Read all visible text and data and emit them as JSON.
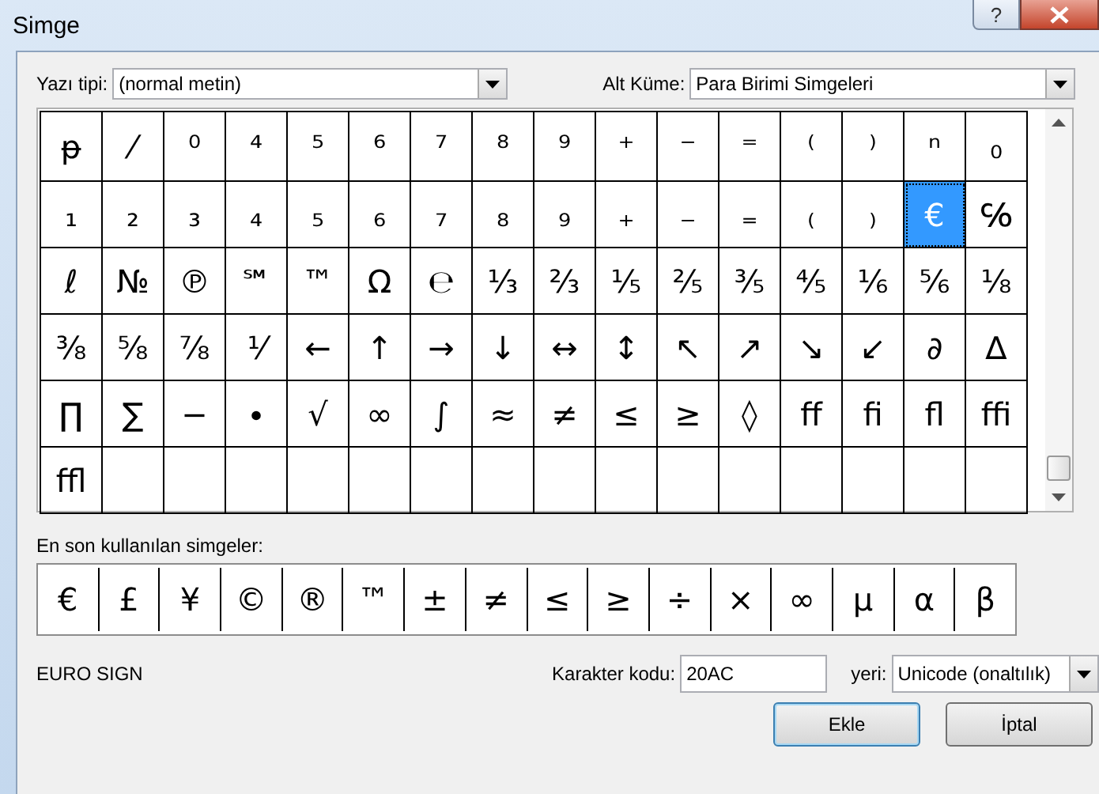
{
  "window": {
    "title": "Simge",
    "help_button": "?"
  },
  "font": {
    "label": "Yazı tipi:",
    "value": "(normal metin)"
  },
  "subset": {
    "label": "Alt Küme:",
    "value": "Para Birimi Simgeleri"
  },
  "grid": [
    [
      {
        "char": "ᵽ",
        "selected": false
      },
      {
        "char": "⁄",
        "selected": false
      },
      {
        "char": "⁰",
        "selected": false
      },
      {
        "char": "⁴",
        "selected": false
      },
      {
        "char": "⁵",
        "selected": false
      },
      {
        "char": "⁶",
        "selected": false
      },
      {
        "char": "⁷",
        "selected": false
      },
      {
        "char": "⁸",
        "selected": false
      },
      {
        "char": "⁹",
        "selected": false
      },
      {
        "char": "⁺",
        "selected": false
      },
      {
        "char": "⁻",
        "selected": false
      },
      {
        "char": "⁼",
        "selected": false
      },
      {
        "char": "⁽",
        "selected": false
      },
      {
        "char": "⁾",
        "selected": false
      },
      {
        "char": "ⁿ",
        "selected": false
      },
      {
        "char": "₀",
        "selected": false
      }
    ],
    [
      {
        "char": "₁",
        "selected": false
      },
      {
        "char": "₂",
        "selected": false
      },
      {
        "char": "₃",
        "selected": false
      },
      {
        "char": "₄",
        "selected": false
      },
      {
        "char": "₅",
        "selected": false
      },
      {
        "char": "₆",
        "selected": false
      },
      {
        "char": "₇",
        "selected": false
      },
      {
        "char": "₈",
        "selected": false
      },
      {
        "char": "₉",
        "selected": false
      },
      {
        "char": "₊",
        "selected": false
      },
      {
        "char": "₋",
        "selected": false
      },
      {
        "char": "₌",
        "selected": false
      },
      {
        "char": "₍",
        "selected": false
      },
      {
        "char": "₎",
        "selected": false
      },
      {
        "char": "€",
        "selected": true
      },
      {
        "char": "℅",
        "selected": false
      }
    ],
    [
      {
        "char": "ℓ",
        "selected": false
      },
      {
        "char": "№",
        "selected": false
      },
      {
        "char": "℗",
        "selected": false
      },
      {
        "char": "℠",
        "selected": false
      },
      {
        "char": "™",
        "selected": false
      },
      {
        "char": "Ω",
        "selected": false
      },
      {
        "char": "℮",
        "selected": false
      },
      {
        "char": "⅓",
        "selected": false
      },
      {
        "char": "⅔",
        "selected": false
      },
      {
        "char": "⅕",
        "selected": false
      },
      {
        "char": "⅖",
        "selected": false
      },
      {
        "char": "⅗",
        "selected": false
      },
      {
        "char": "⅘",
        "selected": false
      },
      {
        "char": "⅙",
        "selected": false
      },
      {
        "char": "⅚",
        "selected": false
      },
      {
        "char": "⅛",
        "selected": false
      }
    ],
    [
      {
        "char": "⅜",
        "selected": false
      },
      {
        "char": "⅝",
        "selected": false
      },
      {
        "char": "⅞",
        "selected": false
      },
      {
        "char": "⅟",
        "selected": false
      },
      {
        "char": "←",
        "selected": false
      },
      {
        "char": "↑",
        "selected": false
      },
      {
        "char": "→",
        "selected": false
      },
      {
        "char": "↓",
        "selected": false
      },
      {
        "char": "↔",
        "selected": false
      },
      {
        "char": "↕",
        "selected": false
      },
      {
        "char": "↖",
        "selected": false
      },
      {
        "char": "↗",
        "selected": false
      },
      {
        "char": "↘",
        "selected": false
      },
      {
        "char": "↙",
        "selected": false
      },
      {
        "char": "∂",
        "selected": false
      },
      {
        "char": "∆",
        "selected": false
      }
    ],
    [
      {
        "char": "∏",
        "selected": false
      },
      {
        "char": "∑",
        "selected": false
      },
      {
        "char": "−",
        "selected": false
      },
      {
        "char": "∙",
        "selected": false
      },
      {
        "char": "√",
        "selected": false
      },
      {
        "char": "∞",
        "selected": false
      },
      {
        "char": "∫",
        "selected": false
      },
      {
        "char": "≈",
        "selected": false
      },
      {
        "char": "≠",
        "selected": false
      },
      {
        "char": "≤",
        "selected": false
      },
      {
        "char": "≥",
        "selected": false
      },
      {
        "char": "◊",
        "selected": false
      },
      {
        "char": "ﬀ",
        "selected": false
      },
      {
        "char": "ﬁ",
        "selected": false
      },
      {
        "char": "ﬂ",
        "selected": false
      },
      {
        "char": "ﬃ",
        "selected": false
      }
    ],
    [
      {
        "char": "ﬄ",
        "selected": false
      }
    ]
  ],
  "recent": {
    "label": "En son kullanılan simgeler:",
    "symbols": [
      "€",
      "£",
      "¥",
      "©",
      "®",
      "™",
      "±",
      "≠",
      "≤",
      "≥",
      "÷",
      "×",
      "∞",
      "µ",
      "α",
      "β"
    ]
  },
  "character_name": "EURO SIGN",
  "code": {
    "label": "Karakter kodu:",
    "value": "20AC"
  },
  "from": {
    "label": "yeri:",
    "value": "Unicode (onaltılık)"
  },
  "buttons": [
    "Ekle",
    "İptal"
  ]
}
